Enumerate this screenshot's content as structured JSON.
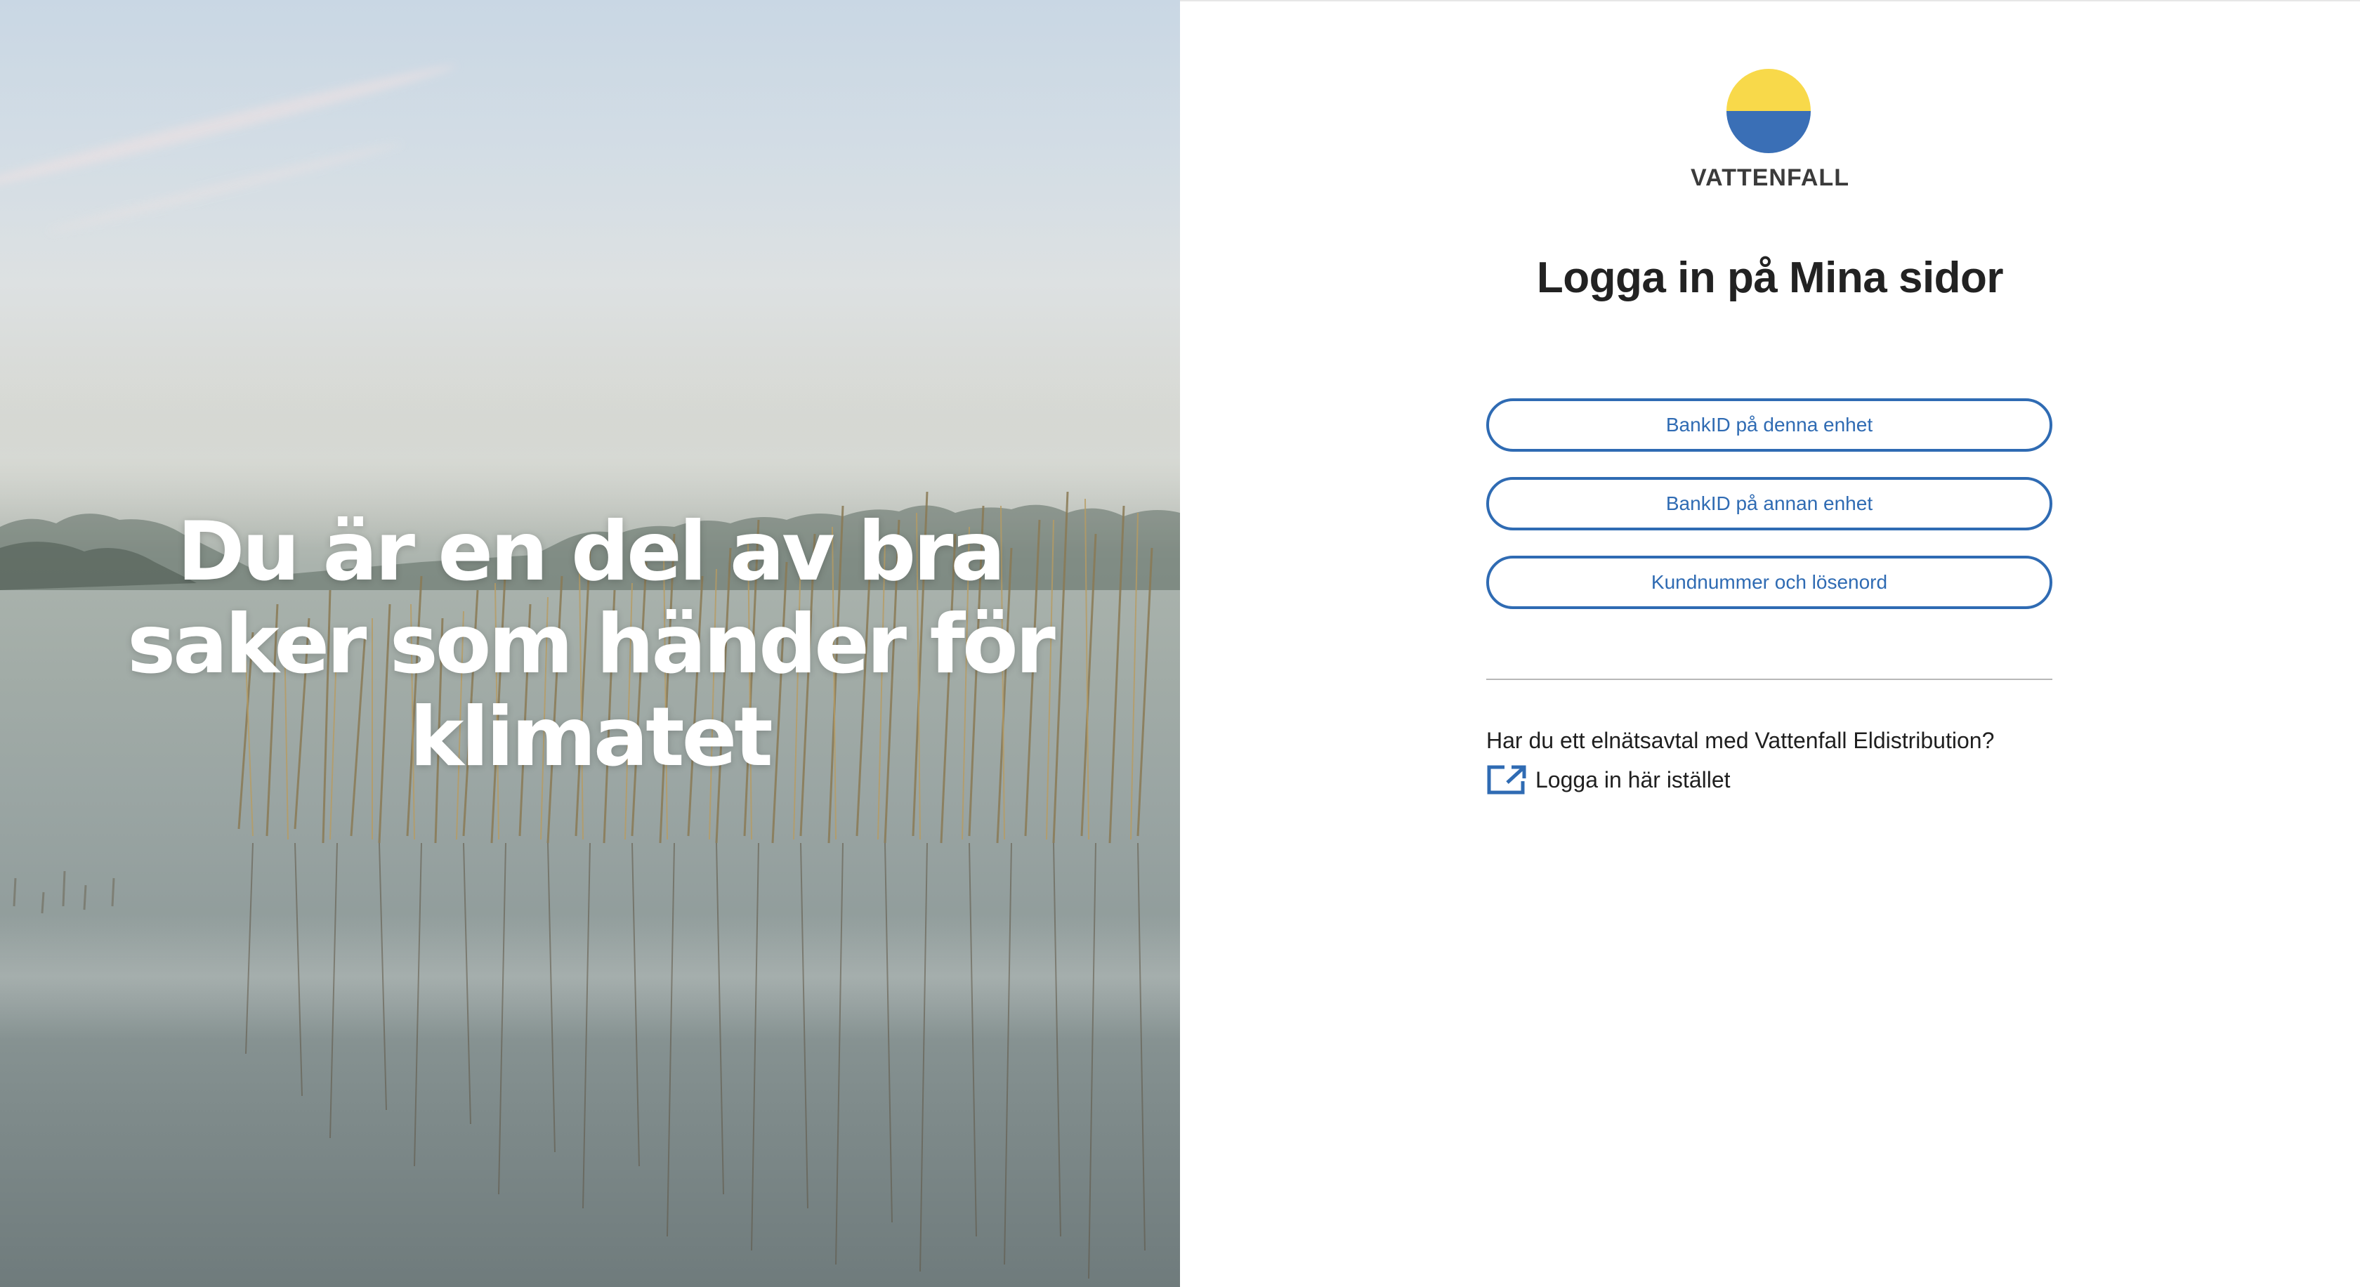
{
  "hero": {
    "headline_lines": [
      "Du är en del av bra",
      "saker som händer för",
      "klimatet"
    ]
  },
  "brand": {
    "name": "VATTENFALL",
    "logo_colors": {
      "top": "#f8d94a",
      "bottom": "#3a6fb6"
    }
  },
  "login": {
    "title": "Logga in på Mina sidor",
    "buttons": [
      {
        "label": "BankID på denna enhet"
      },
      {
        "label": "BankID på annan enhet"
      },
      {
        "label": "Kundnummer och lösenord"
      }
    ],
    "accent_color": "#2f6bb3"
  },
  "alternative": {
    "question": "Har du ett elnätsavtal med Vattenfall Eldistribution?",
    "link_label": "Logga in här istället",
    "link_icon": "external-link-icon"
  }
}
